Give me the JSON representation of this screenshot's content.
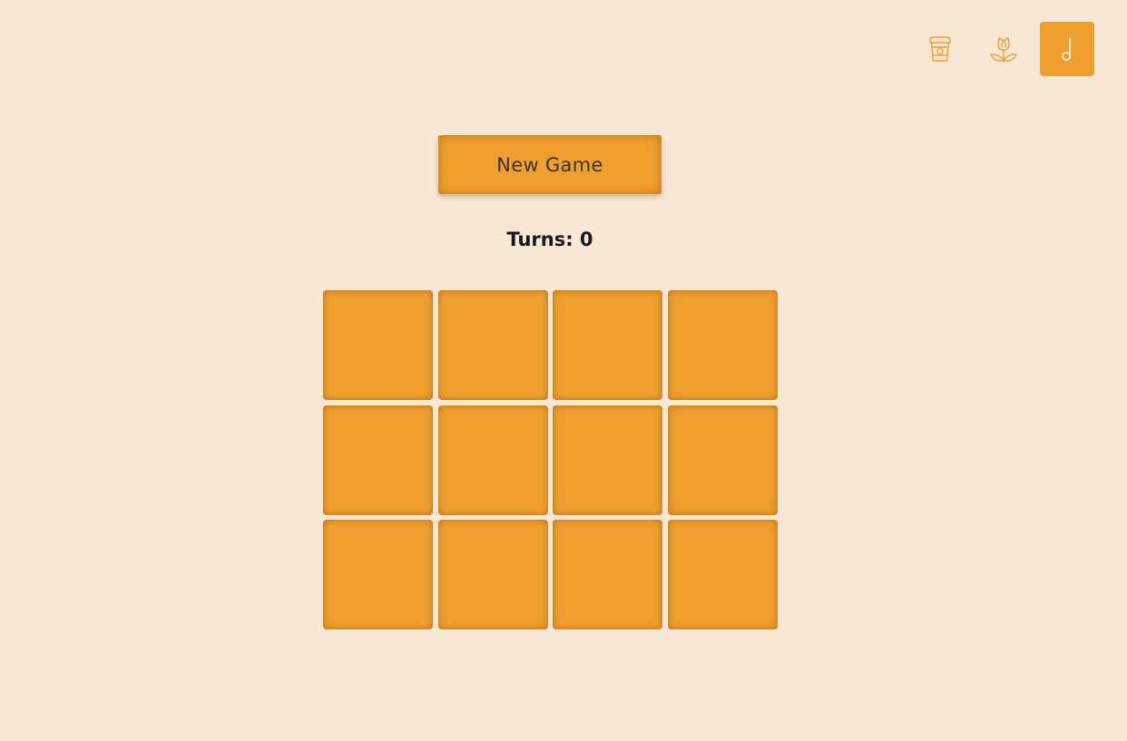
{
  "themes": [
    {
      "icon": "coffee-cup-icon",
      "active": false
    },
    {
      "icon": "flower-icon",
      "active": false
    },
    {
      "icon": "music-note-icon",
      "active": true
    }
  ],
  "controls": {
    "new_game_label": "New Game"
  },
  "status": {
    "turns_label": "Turns:",
    "turns_value": "0"
  },
  "board": {
    "rows": 3,
    "columns": 4,
    "cards": [
      {
        "face": "down"
      },
      {
        "face": "down"
      },
      {
        "face": "down"
      },
      {
        "face": "down"
      },
      {
        "face": "down"
      },
      {
        "face": "down"
      },
      {
        "face": "down"
      },
      {
        "face": "down"
      },
      {
        "face": "down"
      },
      {
        "face": "down"
      },
      {
        "face": "down"
      },
      {
        "face": "down"
      }
    ]
  },
  "colors": {
    "background": "#f8e7d5",
    "accent": "#ee9f2d",
    "text": "#1b1b1f"
  }
}
